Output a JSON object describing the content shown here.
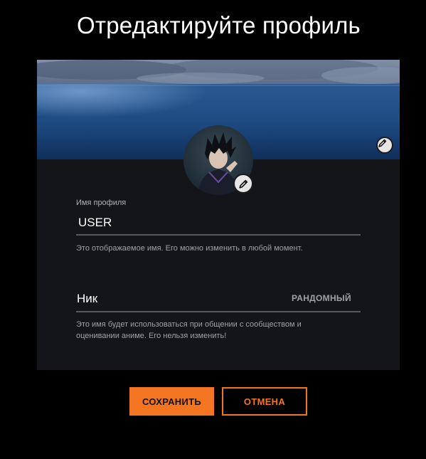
{
  "header": {
    "title": "Отредактируйте профиль"
  },
  "profile": {
    "name_label": "Имя профиля",
    "name_value": "USER",
    "name_help": "Это отображаемое имя. Его можно изменить в любой момент."
  },
  "nickname": {
    "placeholder": "Ник",
    "random_label": "РАНДОМНЫЙ",
    "help": "Это имя будет использоваться при общении с сообществом и оценивании аниме. Его нельзя изменить!"
  },
  "actions": {
    "save_label": "СОХРАНИТЬ",
    "cancel_label": "ОТМЕНА"
  },
  "icons": {
    "banner_edit": "pencil-icon",
    "avatar_edit": "pencil-icon"
  },
  "colors": {
    "accent": "#f47521",
    "background": "#000000",
    "card": "#141519",
    "muted_text": "#a0a0a8"
  }
}
